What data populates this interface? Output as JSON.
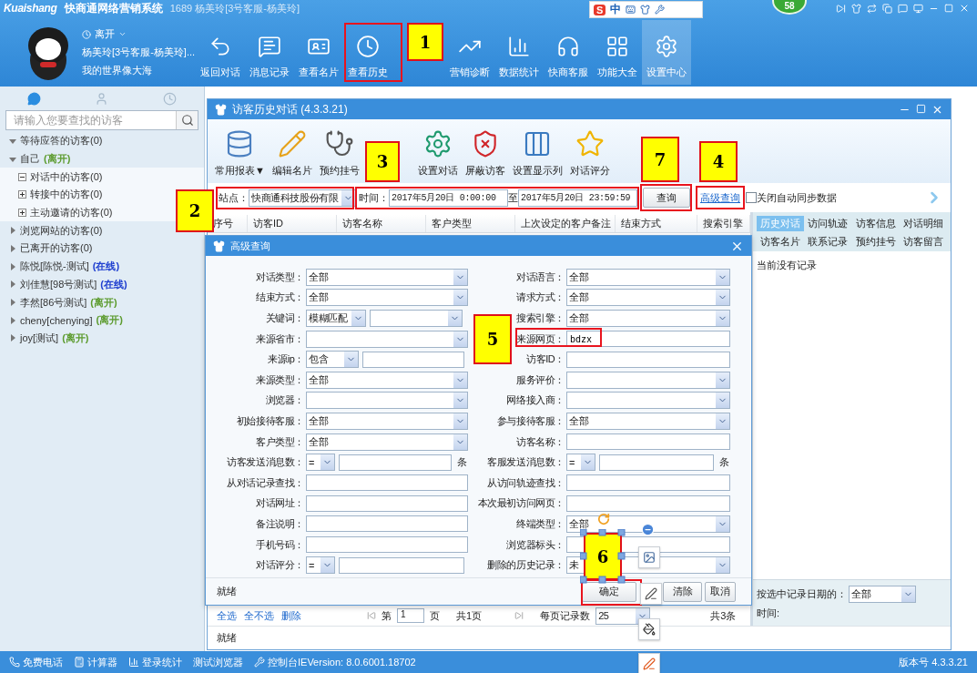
{
  "app": {
    "logo": "Kuaishang",
    "title": "快商通网络营销系统",
    "user_line": "1689 杨美玲[3号客服-杨美玲]",
    "notification_count": "58",
    "ime": {
      "logo": "S",
      "mode": "中"
    }
  },
  "profile": {
    "status": "离开",
    "name": "杨美玲[3号客服-杨美玲]...",
    "motto": "我的世界像大海"
  },
  "toolbar": [
    {
      "label": "返回对话",
      "selected": false
    },
    {
      "label": "消息记录",
      "selected": false
    },
    {
      "label": "查看名片",
      "selected": false
    },
    {
      "label": "查看历史",
      "selected": false
    },
    {
      "label": "营销诊断",
      "selected": false
    },
    {
      "label": "数据统计",
      "selected": false
    },
    {
      "label": "快商客服",
      "selected": false
    },
    {
      "label": "功能大全",
      "selected": false
    },
    {
      "label": "设置中心",
      "selected": true
    }
  ],
  "sidebar": {
    "tabs": [
      {
        "kind": "chat",
        "selected": true
      },
      {
        "kind": "contacts",
        "selected": false
      },
      {
        "kind": "history",
        "selected": false
      }
    ],
    "search": {
      "placeholder": "请输入您要查找的访客"
    },
    "tree": [
      {
        "label": "等待应答的访客(0)",
        "expanded": true
      },
      {
        "label": "自己",
        "status": "(离开)",
        "color": "#5c9b2e",
        "expanded": true,
        "children": [
          {
            "label": "对话中的访客(0)",
            "expanded": true
          },
          {
            "label": "转接中的访客(0)",
            "expanded": false
          },
          {
            "label": "主动邀请的访客(0)",
            "expanded": false
          }
        ]
      },
      {
        "label": "浏览网站的访客(0)",
        "expanded": false
      },
      {
        "label": "已离开的访客(0)",
        "expanded": false
      },
      {
        "label": "陈悦[陈悦-测试]",
        "status": "(在线)",
        "color": "#2040d0",
        "expanded": false
      },
      {
        "label": "刘佳慧[98号测试]",
        "status": "(在线)",
        "color": "#2040d0",
        "expanded": false
      },
      {
        "label": "李然[86号测试]",
        "status": "(离开)",
        "color": "#5c9b2e",
        "expanded": false
      },
      {
        "label": "cheny[chenying]",
        "status": "(离开)",
        "color": "#5c9b2e",
        "expanded": false
      },
      {
        "label": "joy[测试]",
        "status": "(离开)",
        "color": "#5c9b2e",
        "expanded": false
      }
    ]
  },
  "window": {
    "title": "访客历史对话 (4.3.3.21)",
    "tools": [
      {
        "kind": "reports",
        "label": "常用报表▼"
      },
      {
        "kind": "card",
        "label": "编辑名片"
      },
      {
        "kind": "appointment",
        "label": "预约挂号"
      },
      {
        "kind": "settings",
        "label": "设置对话"
      },
      {
        "kind": "block",
        "label": "屏蔽访客"
      },
      {
        "kind": "columns",
        "label": "设置显示列"
      },
      {
        "kind": "rating",
        "label": "对话评分"
      }
    ],
    "filters": {
      "site_label": "站点：",
      "site": "快商通科技股份有限",
      "time_label": "时间：",
      "start": "2017年5月20日 0:00:00",
      "to": "至",
      "end": "2017年5月20日 23:59:59",
      "query": "查询",
      "advanced": "高级查询",
      "sync": {
        "label": "关闭自动同步数据",
        "checked": false
      }
    },
    "table": {
      "columns": [
        "序号",
        "访客ID",
        "访客名称",
        "客户类型",
        "上次设定的客户备注",
        "结束方式",
        "搜索引擎"
      ]
    },
    "pager": {
      "actions": [
        "全选",
        "全不选",
        "删除"
      ],
      "page_prefix": "第",
      "page": "1",
      "page_suffix": "页",
      "total_pages": "共1页",
      "per_page_label": "每页记录数",
      "per_page": "25",
      "total": "共3条"
    },
    "detail": {
      "tabs": [
        {
          "label": "历史对话",
          "selected": true
        },
        {
          "label": "访问轨迹",
          "selected": false
        },
        {
          "label": "访客信息",
          "selected": false
        },
        {
          "label": "对话明细",
          "selected": false
        },
        {
          "label": "访客名片",
          "selected": false
        },
        {
          "label": "联系记录",
          "selected": false
        },
        {
          "label": "预约挂号",
          "selected": false
        },
        {
          "label": "访客留言",
          "selected": false
        }
      ],
      "empty": "当前没有记录",
      "date_filter_label": "按选中记录日期的：",
      "date_filter": "全部",
      "time_label": "时间:"
    },
    "status": "就绪"
  },
  "dialog": {
    "title": "高级查询",
    "left": [
      {
        "label": "对话类型：",
        "kind": "select",
        "value": "全部"
      },
      {
        "label": "结束方式：",
        "kind": "select",
        "value": "全部"
      },
      {
        "label": "关键词：",
        "kind": "select_select",
        "value": "模糊匹配"
      },
      {
        "label": "来源省市：",
        "kind": "select"
      },
      {
        "label": "来源ip：",
        "kind": "select_input",
        "value": "包含"
      },
      {
        "label": "来源类型：",
        "kind": "select",
        "value": "全部"
      },
      {
        "label": "浏览器：",
        "kind": "select"
      },
      {
        "label": "初始接待客服：",
        "kind": "select",
        "value": "全部"
      },
      {
        "label": "客户类型：",
        "kind": "select",
        "value": "全部"
      },
      {
        "label": "访客发送消息数：",
        "kind": "select_input",
        "value": "=",
        "unit": "条"
      },
      {
        "label": "从对话记录查找：",
        "kind": "input"
      },
      {
        "label": "对话网址：",
        "kind": "input"
      },
      {
        "label": "备注说明：",
        "kind": "input"
      },
      {
        "label": "手机号码：",
        "kind": "input"
      },
      {
        "label": "对话评分：",
        "kind": "select_input",
        "value": "="
      }
    ],
    "right": [
      {
        "label": "对话语言：",
        "kind": "select",
        "value": "全部"
      },
      {
        "label": "请求方式：",
        "kind": "select",
        "value": "全部"
      },
      {
        "label": "搜索引擎：",
        "kind": "select",
        "value": "全部"
      },
      {
        "label": "来源网页：",
        "kind": "input",
        "value": "bdzx"
      },
      {
        "label": "访客ID：",
        "kind": "input"
      },
      {
        "label": "服务评价：",
        "kind": "select"
      },
      {
        "label": "网络接入商：",
        "kind": "select"
      },
      {
        "label": "参与接待客服：",
        "kind": "select",
        "value": "全部"
      },
      {
        "label": "访客名称：",
        "kind": "input"
      },
      {
        "label": "客服发送消息数：",
        "kind": "select_input",
        "value": "=",
        "unit": "条"
      },
      {
        "label": "从访问轨迹查找：",
        "kind": "input"
      },
      {
        "label": "本次最初访问网页：",
        "kind": "input"
      },
      {
        "label": "终端类型：",
        "kind": "select",
        "value": "全部"
      },
      {
        "label": "浏览器标头：",
        "kind": "input"
      },
      {
        "label": "删除的历史记录：",
        "kind": "select",
        "value": "未"
      }
    ],
    "status": "就绪",
    "buttons": [
      "确定",
      "清除",
      "取消"
    ]
  },
  "annotations": [
    {
      "label": "1"
    },
    {
      "label": "2"
    },
    {
      "label": "3"
    },
    {
      "label": "4"
    },
    {
      "label": "5"
    },
    {
      "label": "6"
    },
    {
      "label": "7"
    }
  ],
  "status_bar": {
    "items": [
      "免费电话",
      "计算器",
      "登录统计",
      "测试浏览器",
      "控制台IEVersion: 8.0.6001.18702"
    ],
    "version": "版本号 4.3.3.21"
  }
}
